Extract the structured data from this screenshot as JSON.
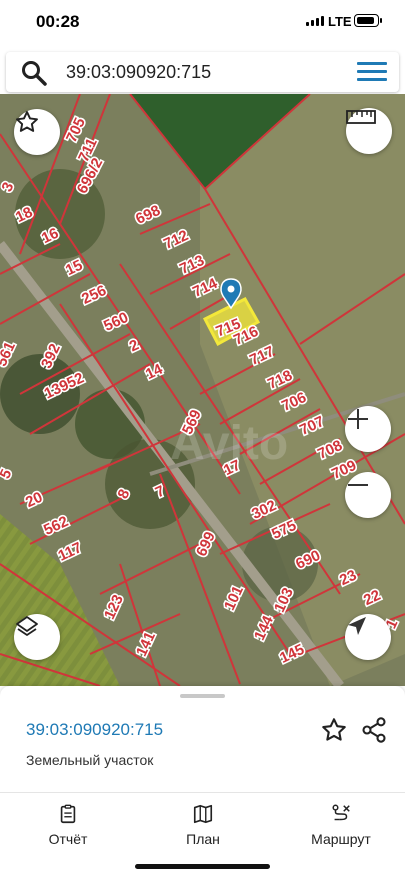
{
  "status_bar": {
    "time": "00:28",
    "network": "LTE"
  },
  "search": {
    "query": "39:03:090920:715"
  },
  "map": {
    "plots": [
      {
        "label": "705"
      },
      {
        "label": "711"
      },
      {
        "label": "3"
      },
      {
        "label": "18"
      },
      {
        "label": "696/2"
      },
      {
        "label": "16"
      },
      {
        "label": "698"
      },
      {
        "label": "712"
      },
      {
        "label": "713"
      },
      {
        "label": "714"
      },
      {
        "label": "15"
      },
      {
        "label": "256"
      },
      {
        "label": "560"
      },
      {
        "label": "561"
      },
      {
        "label": "392"
      },
      {
        "label": "2"
      },
      {
        "label": "716"
      },
      {
        "label": "717"
      },
      {
        "label": "14"
      },
      {
        "label": "13952"
      },
      {
        "label": "718"
      },
      {
        "label": "706"
      },
      {
        "label": "569"
      },
      {
        "label": "707"
      },
      {
        "label": "708"
      },
      {
        "label": "709"
      },
      {
        "label": "17"
      },
      {
        "label": "5"
      },
      {
        "label": "20"
      },
      {
        "label": "8"
      },
      {
        "label": "7"
      },
      {
        "label": "302"
      },
      {
        "label": "575"
      },
      {
        "label": "562"
      },
      {
        "label": "117"
      },
      {
        "label": "699"
      },
      {
        "label": "690"
      },
      {
        "label": "23"
      },
      {
        "label": "123"
      },
      {
        "label": "101"
      },
      {
        "label": "103"
      },
      {
        "label": "22"
      },
      {
        "label": "141"
      },
      {
        "label": "144"
      },
      {
        "label": "145"
      },
      {
        "label": "1"
      }
    ],
    "selected_label": "715",
    "watermark": "Avito"
  },
  "selected": {
    "cadastral_number": "39:03:090920:715",
    "type": "Земельный участок"
  },
  "nav": {
    "report": "Отчёт",
    "plan": "План",
    "route": "Маршрут"
  },
  "colors": {
    "accent": "#1f7ab5",
    "plot_border": "#d0353a",
    "selected_plot": "#f3e83a"
  }
}
